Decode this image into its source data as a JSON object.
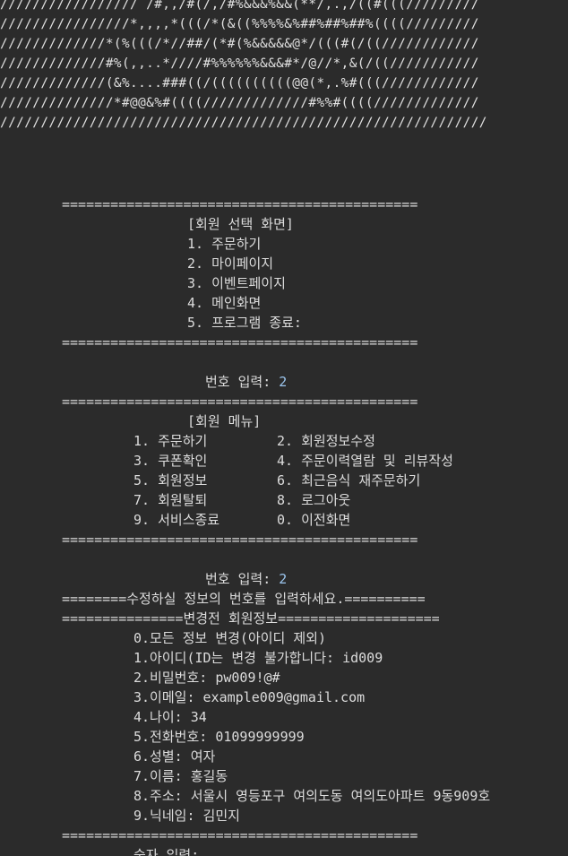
{
  "ascii_art": [
    "///////////////// /#,,/#(/,/#%&&&%&&(**/,.,/((#(((/////////",
    "////////////////*,,,,*(((/*(&((%%%%&%##%##%##%((((/////////",
    "/////////////*(%(((/*//##/(*#(%&&&&&@*/(((#(/((////////////",
    "/////////////#%(,,..*////#%%%%%%&&&#*/@//*,&(/((///////////",
    "/////////////(&%....###((/((((((((((@@(*,.%#(((////////////",
    "//////////////*#@@&%#((((/////////////#%%#((((/////////////",
    "////////////////////////////////////////////////////////////"
  ],
  "divider": "============================================",
  "select_screen": {
    "title": "[회원 선택 화면]",
    "items": [
      "1. 주문하기",
      "2. 마이페이지",
      "3. 이벤트페이지",
      "4. 메인화면",
      "5. 프로그램 종료:"
    ]
  },
  "prompt1": {
    "label": "번호 입력: ",
    "value": "2"
  },
  "member_menu": {
    "title": "[회원 메뉴]",
    "left": [
      "1. 주문하기",
      "3. 쿠폰확인",
      "5. 회원정보",
      "7. 회원탈퇴",
      "9. 서비스종료"
    ],
    "right": [
      "2. 회원정보수정",
      "4. 주문이력열람 및 리뷰작성",
      "6. 최근음식 재주문하기",
      "8. 로그아웃",
      "0. 이전화면"
    ]
  },
  "prompt2": {
    "label": "번호 입력: ",
    "value": "2"
  },
  "edit_header": "========수정하실 정보의 번호를 입력하세요.==========",
  "before_header": "===============변경전 회원정보====================",
  "info_lines": [
    "0.모든 정보 변경(아이디 제외)",
    "1.아이디(ID는 변경 불가합니다: id009",
    "2.비밀번호: pw009!@#",
    "3.이메일: example009@gmail.com",
    "4.나이: 34",
    "5.전화번호: 01099999999",
    "6.성별: 여자",
    "7.이름: 홍길동",
    "8.주소: 서울시 영등포구 여의도동 여의도아파트 9동909호",
    "9.닉네임: 김민지"
  ],
  "prompt3": {
    "label": "숫자 입력:"
  }
}
